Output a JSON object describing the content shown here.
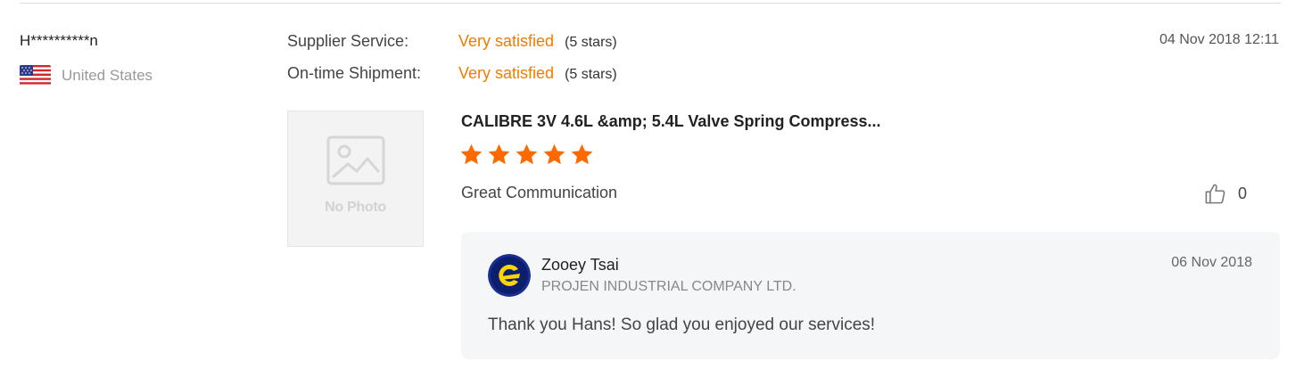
{
  "buyer": {
    "name": "H**********n",
    "country": "United States",
    "flag_icon": "us-flag-icon"
  },
  "ratings": [
    {
      "label": "Supplier Service:",
      "value": "Very satisfied",
      "stars_text": "(5 stars)"
    },
    {
      "label": "On-time Shipment:",
      "value": "Very satisfied",
      "stars_text": "(5 stars)"
    }
  ],
  "review": {
    "date": "04 Nov 2018 12:11",
    "photo_placeholder": "No Photo",
    "product_title": "CALIBRE 3V 4.6L &amp; 5.4L Valve Spring Compress...",
    "star_rating": 5,
    "text": "Great Communication",
    "like_count": "0"
  },
  "reply": {
    "name": "Zooey Tsai",
    "company": "PROJEN INDUSTRIAL COMPANY LTD.",
    "date": "06 Nov 2018",
    "text": "Thank you Hans! So glad you enjoyed our services!"
  },
  "colors": {
    "accent": "#f07c00",
    "star": "#ff6a00",
    "reply_bg": "#f5f6f7"
  }
}
